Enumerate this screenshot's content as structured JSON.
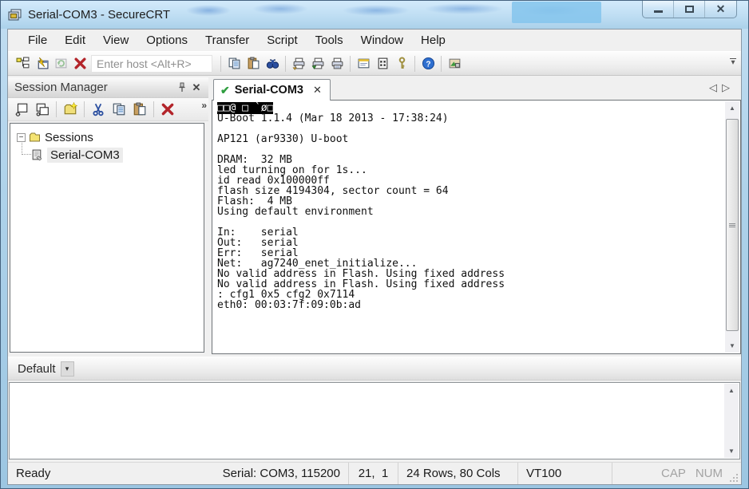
{
  "window": {
    "title": "Serial-COM3 - SecureCRT"
  },
  "menu": {
    "items": [
      "File",
      "Edit",
      "View",
      "Options",
      "Transfer",
      "Script",
      "Tools",
      "Window",
      "Help"
    ]
  },
  "toolbar": {
    "host_placeholder": "Enter host <Alt+R>"
  },
  "session_manager": {
    "title": "Session Manager",
    "root_label": "Sessions",
    "session_label": "Serial-COM3"
  },
  "tab": {
    "label": "Serial-COM3"
  },
  "terminal": {
    "first_line_inverse": true,
    "lines": [
      "□□@ □ `ø□",
      "U-Boot 1.1.4 (Mar 18 2013 - 17:38:24)",
      "",
      "AP121 (ar9330) U-boot",
      "",
      "DRAM:  32 MB",
      "led turning on for 1s...",
      "id read 0x100000ff",
      "flash size 4194304, sector count = 64",
      "Flash:  4 MB",
      "Using default environment",
      "",
      "In:    serial",
      "Out:   serial",
      "Err:   serial",
      "Net:   ag7240_enet_initialize...",
      "No valid address in Flash. Using fixed address",
      "No valid address in Flash. Using fixed address",
      ": cfg1 0x5 cfg2 0x7114",
      "eth0: 00:03:7f:09:0b:ad"
    ]
  },
  "button_bar": {
    "label": "Default"
  },
  "status": {
    "ready": "Ready",
    "connection": "Serial: COM3, 115200",
    "cursor": "21,  1",
    "grid": "24 Rows, 80 Cols",
    "emulation": "VT100",
    "caps": "CAP",
    "num": "NUM"
  },
  "icons": {
    "overflow_chevrons": "»",
    "dropdown_arrow": "▾",
    "scroll_up": "▲",
    "scroll_down": "▼",
    "tab_prev": "◁",
    "tab_next": "▷",
    "tab_check": "✔",
    "close_x": "✕",
    "tree_collapse": "−"
  },
  "colors": {
    "titlebar_blue": "#bcdcf2",
    "tab_check_green": "#2f9e3f",
    "danger_red": "#b3242a",
    "terminal_fg": "#101010",
    "terminal_bg": "#ffffff"
  }
}
